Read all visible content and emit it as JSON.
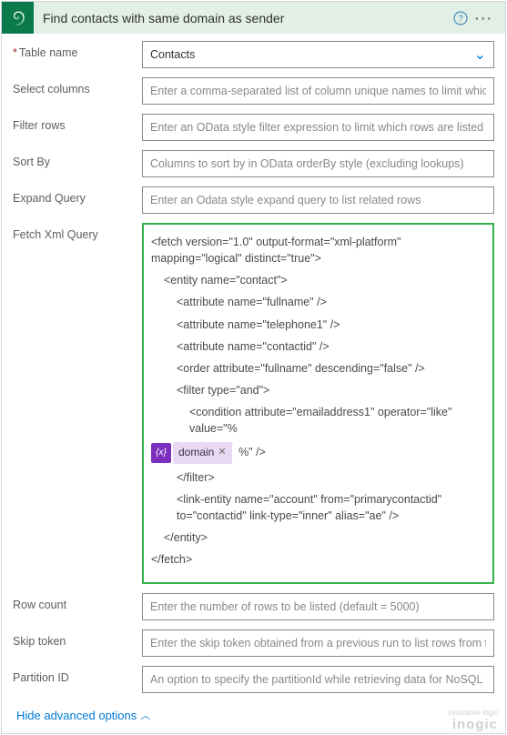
{
  "header": {
    "title": "Find contacts with same domain as sender"
  },
  "fields": {
    "table_name": {
      "label": "Table name",
      "value": "Contacts"
    },
    "select_columns": {
      "label": "Select columns",
      "placeholder": "Enter a comma-separated list of column unique names to limit which columns a"
    },
    "filter_rows": {
      "label": "Filter rows",
      "placeholder": "Enter an OData style filter expression to limit which rows are listed"
    },
    "sort_by": {
      "label": "Sort By",
      "placeholder": "Columns to sort by in OData orderBy style (excluding lookups)"
    },
    "expand_query": {
      "label": "Expand Query",
      "placeholder": "Enter an Odata style expand query to list related rows"
    },
    "fetch_xml": {
      "label": "Fetch Xml Query"
    },
    "row_count": {
      "label": "Row count",
      "placeholder": "Enter the number of rows to be listed (default = 5000)"
    },
    "skip_token": {
      "label": "Skip token",
      "placeholder": "Enter the skip token obtained from a previous run to list rows from the next pag"
    },
    "partition_id": {
      "label": "Partition ID",
      "placeholder": "An option to specify the partitionId while retrieving data for NoSQL tables"
    }
  },
  "fetchxml": {
    "l1": "<fetch version=\"1.0\" output-format=\"xml-platform\" mapping=\"logical\" distinct=\"true\">",
    "l2": "<entity name=\"contact\">",
    "l3": "<attribute name=\"fullname\" />",
    "l4": "<attribute name=\"telephone1\" />",
    "l5": "<attribute name=\"contactid\" />",
    "l6": "<order attribute=\"fullname\" descending=\"false\" />",
    "l7": "<filter type=\"and\">",
    "l8a": "<condition attribute=\"emailaddress1\" operator=\"like\" value=\"%",
    "token": "domain",
    "l8b": "%\" />",
    "l9": "</filter>",
    "l10": "<link-entity name=\"account\" from=\"primarycontactid\" to=\"contactid\" link-type=\"inner\" alias=\"ae\" />",
    "l11": "</entity>",
    "l12": "</fetch>"
  },
  "advanced": {
    "label": "Hide advanced options"
  },
  "watermark": {
    "top": "innovative logic",
    "brand": "inogic"
  }
}
